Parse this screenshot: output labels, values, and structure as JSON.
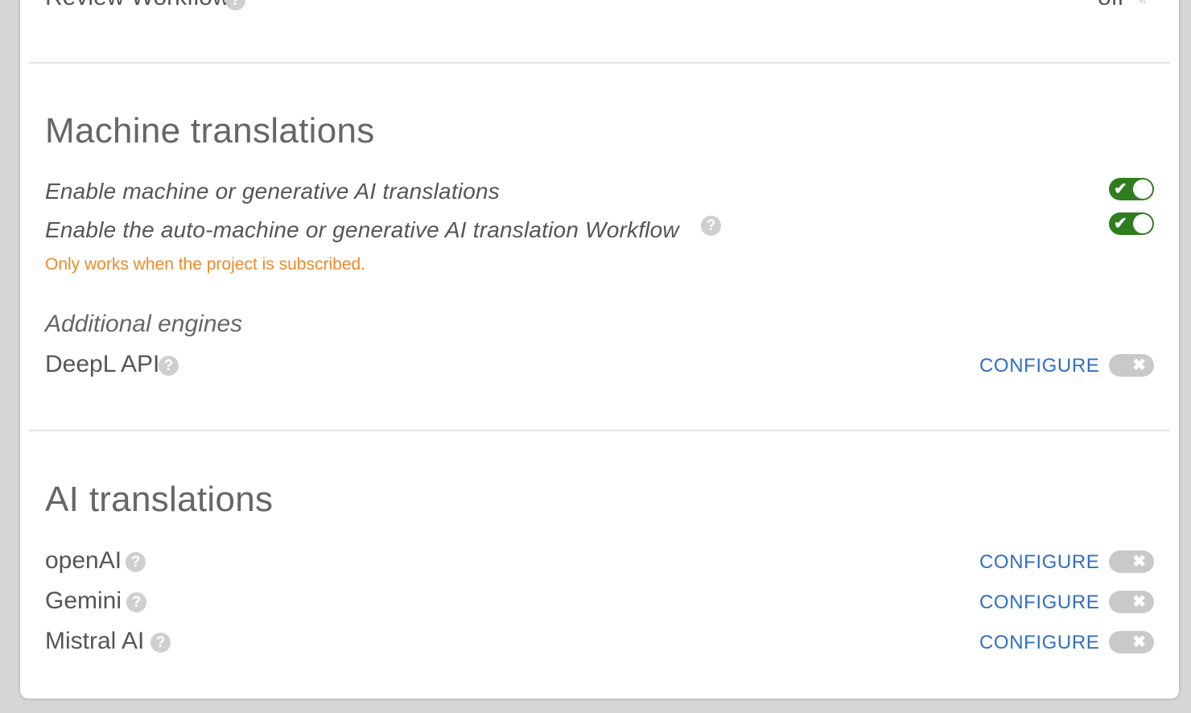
{
  "top_row": {
    "label": "Review Workflow",
    "value": "off"
  },
  "machine": {
    "title": "Machine translations",
    "options": [
      {
        "label": "Enable machine or generative AI translations",
        "state": "on"
      },
      {
        "label": "Enable the auto-machine or generative AI translation Workflow",
        "state": "on"
      }
    ],
    "warning": "Only works when the project is subscribed.",
    "additional_label": "Additional engines",
    "engines": [
      {
        "name": "DeepL API",
        "action": "CONFIGURE",
        "state": "off"
      }
    ]
  },
  "ai": {
    "title": "AI translations",
    "engines": [
      {
        "name": "openAI",
        "action": "CONFIGURE",
        "state": "off"
      },
      {
        "name": "Gemini",
        "action": "CONFIGURE",
        "state": "off"
      },
      {
        "name": "Mistral AI",
        "action": "CONFIGURE",
        "state": "off"
      }
    ]
  },
  "icons": {
    "help": "?",
    "check": "✔",
    "cross": "✖",
    "edit": "✎"
  },
  "colors": {
    "accent_link": "#2f6fc4",
    "toggle_on": "#2f7d1f",
    "toggle_off": "#c9c9c9",
    "warning": "#ed8a27"
  }
}
